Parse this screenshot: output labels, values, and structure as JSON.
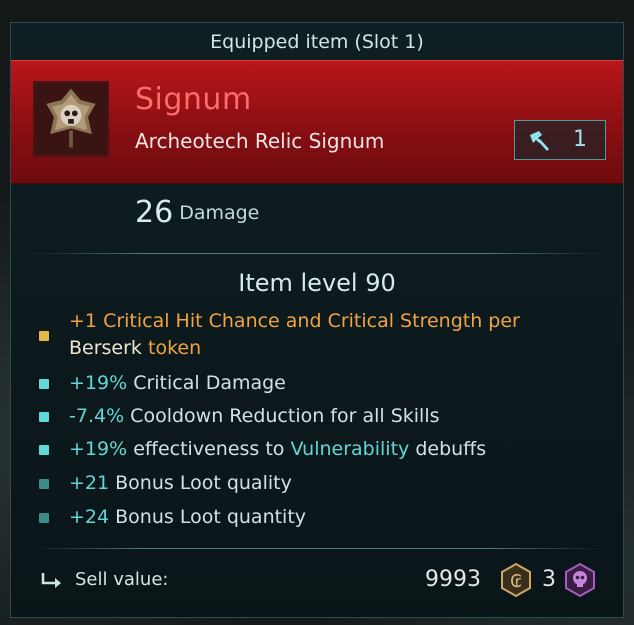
{
  "tooltip": {
    "header_title": "Equipped item (Slot 1)",
    "item_name": "Signum",
    "item_subtitle": "Archeotech Relic Signum",
    "weapon_slot_count": "1",
    "damage_value": "26",
    "damage_label": "Damage",
    "item_level_label": "Item level 90"
  },
  "affixes": [
    {
      "bullet_color": "#e6b54a",
      "line1": {
        "a": "+1 ",
        "b": "Critical Hit Chance and Critical Strength per"
      },
      "line2": {
        "a": "Berserk",
        "b": " token"
      }
    },
    {
      "bullet_color": "#5fd9d9",
      "value": "+19%",
      "text": " Critical Damage"
    },
    {
      "bullet_color": "#5fd9d9",
      "value": "-7.4%",
      "text": " Cooldown Reduction for all Skills"
    },
    {
      "bullet_color": "#5fd9d9",
      "value": "+19%",
      "text": " effectiveness to ",
      "highlight": "Vulnerability",
      "tail": " debuffs"
    },
    {
      "bullet_color": "#3c8a8a",
      "value": "+21",
      "text": " Bonus Loot quality"
    },
    {
      "bullet_color": "#3c8a8a",
      "value": "+24",
      "text": " Bonus Loot quantity"
    }
  ],
  "sell": {
    "label": "Sell value:",
    "gold_amount": "9993",
    "skull_amount": "3",
    "gold_icon": "credits-coin-icon",
    "skull_icon": "skull-token-icon"
  },
  "colors": {
    "banner": "#a0141a",
    "item_name": "#ff6b6b",
    "accent_teal": "#62d6d6",
    "accent_orange": "#f0a341"
  }
}
